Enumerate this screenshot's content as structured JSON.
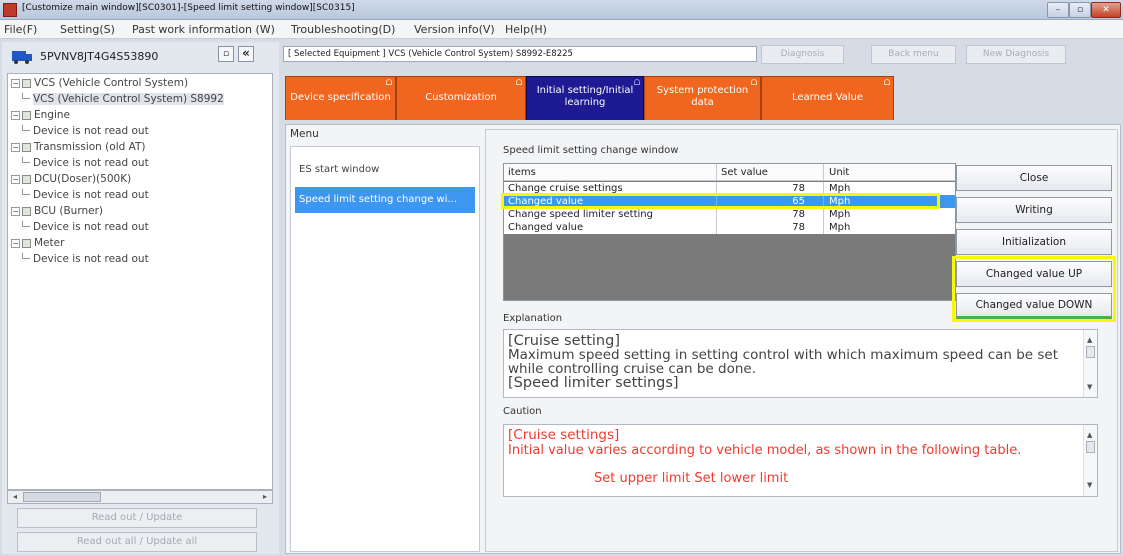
{
  "window": {
    "title": "[Customize main window][SC0301]-[Speed limit setting window][SC0315]",
    "controls": {
      "minimize": "–",
      "maximize": "▫",
      "close": "✕"
    }
  },
  "menubar": {
    "items": [
      "File(F)",
      "Setting(S)",
      "Past work information (W)",
      "Troubleshooting(D)",
      "Version info(V)",
      "Help(H)"
    ]
  },
  "left": {
    "vin": "5PVNV8JT4G4S53890",
    "buttons": {
      "small": "▫",
      "collapse": "«"
    },
    "tree": [
      {
        "label": "VCS (Vehicle Control System)"
      },
      {
        "label": "VCS (Vehicle Control System) S8992"
      },
      {
        "label": "Engine"
      },
      {
        "label": "Device is not read out"
      },
      {
        "label": "Transmission (old AT)"
      },
      {
        "label": "Device is not read out"
      },
      {
        "label": "DCU(Doser)(500K)"
      },
      {
        "label": "Device is not read out"
      },
      {
        "label": "BCU (Burner)"
      },
      {
        "label": "Device is not read out"
      },
      {
        "label": "Meter"
      },
      {
        "label": "Device is not read out"
      }
    ],
    "scroll": {
      "left": "◂",
      "right": "▸",
      "grip": "≡"
    },
    "read_out_update": "Read out / Update",
    "read_out_all": "Read out all / Update all"
  },
  "right": {
    "selected_equipment": "[ Selected Equipment ] VCS (Vehicle Control System) S8992-E8225",
    "top_buttons": {
      "diagnosis": "Diagnosis",
      "back_menu": "Back menu",
      "new_diagnosis": "New Diagnosis"
    },
    "tabs": [
      {
        "label": "Device specification",
        "active": false
      },
      {
        "label": "Customization",
        "active": false
      },
      {
        "label": "Initial setting/Initial learning",
        "active": true
      },
      {
        "label": "System protection data",
        "active": false
      },
      {
        "label": "Learned Value",
        "active": false
      }
    ],
    "menu": {
      "label": "Menu",
      "items": [
        "ES start window",
        "Speed limit setting change wi..."
      ],
      "selected": 1
    },
    "window_title": "Speed limit setting change window",
    "table": {
      "headers": [
        "items",
        "Set value",
        "Unit"
      ],
      "rows": [
        {
          "item": "Change cruise settings",
          "value": "78",
          "unit": "Mph"
        },
        {
          "item": "Changed value",
          "value": "65",
          "unit": "Mph"
        },
        {
          "item": "Change speed limiter setting",
          "value": "78",
          "unit": "Mph"
        },
        {
          "item": "Changed value",
          "value": "78",
          "unit": "Mph"
        }
      ],
      "selected_row": 1
    },
    "buttons": {
      "close": "Close",
      "writing": "Writing",
      "initialization": "Initialization",
      "up": "Changed value UP",
      "down": "Changed value DOWN"
    },
    "explanation": {
      "label": "Explanation",
      "lines": [
        "[Cruise setting]",
        "Maximum speed setting in setting control with which maximum speed can be set",
        "while controlling cruise can be done.",
        "[Speed limiter settings]"
      ]
    },
    "caution": {
      "label": "Caution",
      "lines": [
        "[Cruise settings]",
        "Initial value varies according to vehicle model, as shown in the following table.",
        "Set upper limit  Set lower limit",
        ""
      ]
    },
    "scroll": {
      "up": "▲",
      "down": "▼"
    }
  },
  "colors": {
    "tab_orange": "#f0661e",
    "tab_active": "#1d1a93",
    "selection_blue": "#3d97f0",
    "highlight_yellow": "#f7f70b",
    "caution_red": "#ef3b2f"
  }
}
